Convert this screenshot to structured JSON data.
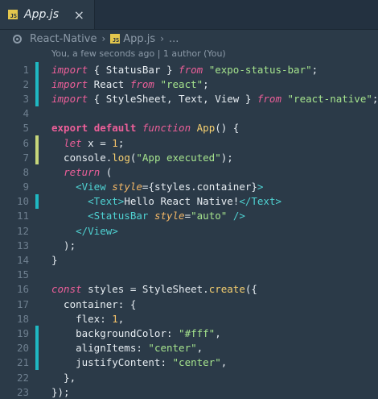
{
  "tab": {
    "icon": "js-icon",
    "icon_text": "JS",
    "title": "App.js",
    "close": "×"
  },
  "breadcrumb": {
    "repo_icon": "repo-icon",
    "project": "React-Native",
    "file_icon_text": "JS",
    "file": "App.js",
    "more": "..."
  },
  "blame": "You, a few seconds ago | 1 author (You)",
  "colors": {
    "added": "#1fb8c2",
    "modified": "#c6d67a",
    "keyword": "#ec5f99",
    "string": "#a5e38d",
    "tag": "#4fd2d2"
  },
  "lines": [
    {
      "n": "1",
      "mark": "added",
      "tokens": [
        [
          "kw",
          "import"
        ],
        [
          "punc",
          " { StatusBar } "
        ],
        [
          "kw",
          "from"
        ],
        [
          "punc",
          " "
        ],
        [
          "str",
          "\"expo-status-bar\""
        ],
        [
          "punc",
          ";"
        ]
      ]
    },
    {
      "n": "2",
      "mark": "added",
      "tokens": [
        [
          "kw",
          "import"
        ],
        [
          "punc",
          " React "
        ],
        [
          "kw",
          "from"
        ],
        [
          "punc",
          " "
        ],
        [
          "str",
          "\"react\""
        ],
        [
          "punc",
          ";"
        ]
      ]
    },
    {
      "n": "3",
      "mark": "added",
      "tokens": [
        [
          "kw",
          "import"
        ],
        [
          "punc",
          " { StyleSheet, Text, View } "
        ],
        [
          "kw",
          "from"
        ],
        [
          "punc",
          " "
        ],
        [
          "str",
          "\"react-native\""
        ],
        [
          "punc",
          ";"
        ]
      ]
    },
    {
      "n": "4",
      "mark": "",
      "tokens": []
    },
    {
      "n": "5",
      "mark": "",
      "tokens": [
        [
          "kw2",
          "export"
        ],
        [
          "punc",
          " "
        ],
        [
          "kw2",
          "default"
        ],
        [
          "punc",
          " "
        ],
        [
          "kw",
          "function"
        ],
        [
          "punc",
          " "
        ],
        [
          "fn",
          "App"
        ],
        [
          "punc",
          "() {"
        ]
      ]
    },
    {
      "n": "6",
      "mark": "modified",
      "tokens": [
        [
          "punc",
          "  "
        ],
        [
          "kw",
          "let"
        ],
        [
          "punc",
          " x = "
        ],
        [
          "num",
          "1"
        ],
        [
          "punc",
          ";"
        ]
      ]
    },
    {
      "n": "7",
      "mark": "modified",
      "tokens": [
        [
          "punc",
          "  console."
        ],
        [
          "fn",
          "log"
        ],
        [
          "punc",
          "("
        ],
        [
          "str",
          "\"App executed\""
        ],
        [
          "punc",
          ");"
        ]
      ]
    },
    {
      "n": "8",
      "mark": "",
      "tokens": [
        [
          "punc",
          "  "
        ],
        [
          "kw",
          "return"
        ],
        [
          "punc",
          " ("
        ]
      ]
    },
    {
      "n": "9",
      "mark": "",
      "tokens": [
        [
          "punc",
          "    "
        ],
        [
          "tag",
          "<View"
        ],
        [
          "punc",
          " "
        ],
        [
          "attr",
          "style"
        ],
        [
          "punc",
          "={styles.container}"
        ],
        [
          "tag",
          ">"
        ]
      ]
    },
    {
      "n": "10",
      "mark": "added",
      "tokens": [
        [
          "punc",
          "      "
        ],
        [
          "tag",
          "<Text>"
        ],
        [
          "punc",
          "Hello React Native!"
        ],
        [
          "tag",
          "</Text>"
        ]
      ]
    },
    {
      "n": "11",
      "mark": "",
      "tokens": [
        [
          "punc",
          "      "
        ],
        [
          "tag",
          "<StatusBar"
        ],
        [
          "punc",
          " "
        ],
        [
          "attr",
          "style"
        ],
        [
          "punc",
          "="
        ],
        [
          "str",
          "\"auto\""
        ],
        [
          "punc",
          " "
        ],
        [
          "tag",
          "/>"
        ]
      ]
    },
    {
      "n": "12",
      "mark": "",
      "tokens": [
        [
          "punc",
          "    "
        ],
        [
          "tag",
          "</View>"
        ]
      ]
    },
    {
      "n": "13",
      "mark": "",
      "tokens": [
        [
          "punc",
          "  );"
        ]
      ]
    },
    {
      "n": "14",
      "mark": "",
      "tokens": [
        [
          "punc",
          "}"
        ]
      ]
    },
    {
      "n": "15",
      "mark": "",
      "tokens": []
    },
    {
      "n": "16",
      "mark": "",
      "tokens": [
        [
          "kw",
          "const"
        ],
        [
          "punc",
          " styles = StyleSheet."
        ],
        [
          "fn",
          "create"
        ],
        [
          "punc",
          "({"
        ]
      ]
    },
    {
      "n": "17",
      "mark": "",
      "tokens": [
        [
          "punc",
          "  container: {"
        ]
      ]
    },
    {
      "n": "18",
      "mark": "",
      "tokens": [
        [
          "punc",
          "    flex: "
        ],
        [
          "num",
          "1"
        ],
        [
          "punc",
          ","
        ]
      ]
    },
    {
      "n": "19",
      "mark": "added",
      "tokens": [
        [
          "punc",
          "    backgroundColor: "
        ],
        [
          "str",
          "\"#fff\""
        ],
        [
          "punc",
          ","
        ]
      ]
    },
    {
      "n": "20",
      "mark": "added",
      "tokens": [
        [
          "punc",
          "    alignItems: "
        ],
        [
          "str",
          "\"center\""
        ],
        [
          "punc",
          ","
        ]
      ]
    },
    {
      "n": "21",
      "mark": "added",
      "tokens": [
        [
          "punc",
          "    justifyContent: "
        ],
        [
          "str",
          "\"center\""
        ],
        [
          "punc",
          ","
        ]
      ]
    },
    {
      "n": "22",
      "mark": "",
      "tokens": [
        [
          "punc",
          "  },"
        ]
      ]
    },
    {
      "n": "23",
      "mark": "",
      "tokens": [
        [
          "punc",
          "});"
        ]
      ]
    }
  ]
}
